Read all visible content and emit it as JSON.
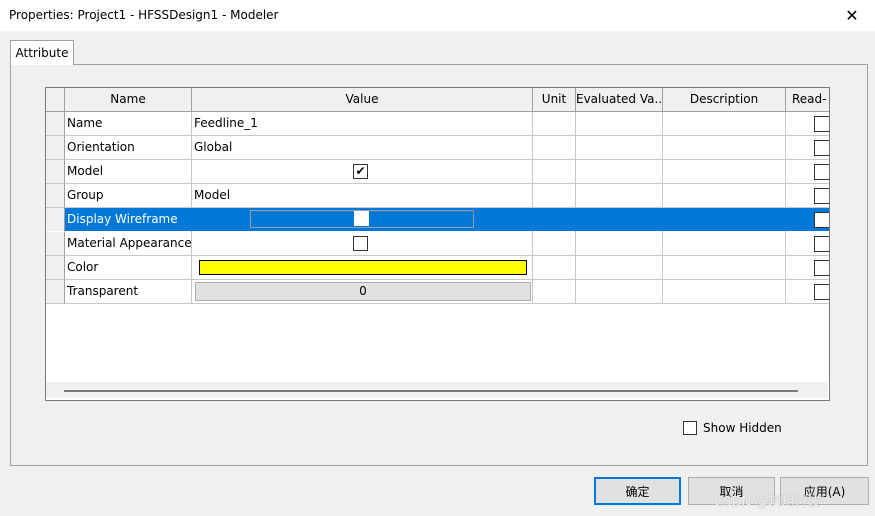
{
  "window": {
    "title": "Properties: Project1 - HFSSDesign1 - Modeler",
    "close_glyph": "✕"
  },
  "tabs": [
    {
      "label": "Attribute"
    }
  ],
  "grid": {
    "columns": [
      "Name",
      "Value",
      "Unit",
      "Evaluated Va...",
      "Description",
      "Read-"
    ],
    "rows": [
      {
        "name": "Name",
        "value": "Feedline_1",
        "type": "text"
      },
      {
        "name": "Orientation",
        "value": "Global",
        "type": "text"
      },
      {
        "name": "Model",
        "value": "✔",
        "type": "checkbox",
        "checked": true
      },
      {
        "name": "Group",
        "value": "Model",
        "type": "text"
      },
      {
        "name": "Display Wireframe",
        "value": "",
        "type": "checkbox",
        "checked": false,
        "selected": true
      },
      {
        "name": "Material Appearance",
        "value": "",
        "type": "checkbox",
        "checked": false
      },
      {
        "name": "Color",
        "value": "",
        "type": "color",
        "color": "#ffff00"
      },
      {
        "name": "Transparent",
        "value": "0",
        "type": "button"
      }
    ]
  },
  "show_hidden": {
    "label": "Show Hidden",
    "checked": false
  },
  "buttons": {
    "ok": "确定",
    "cancel": "取消",
    "apply": "应用(A)"
  },
  "watermark": "CSDN @玥玥行波",
  "colors": {
    "selection": "#0078d7",
    "swatch": "#ffff00",
    "accent": "#0078d7"
  }
}
